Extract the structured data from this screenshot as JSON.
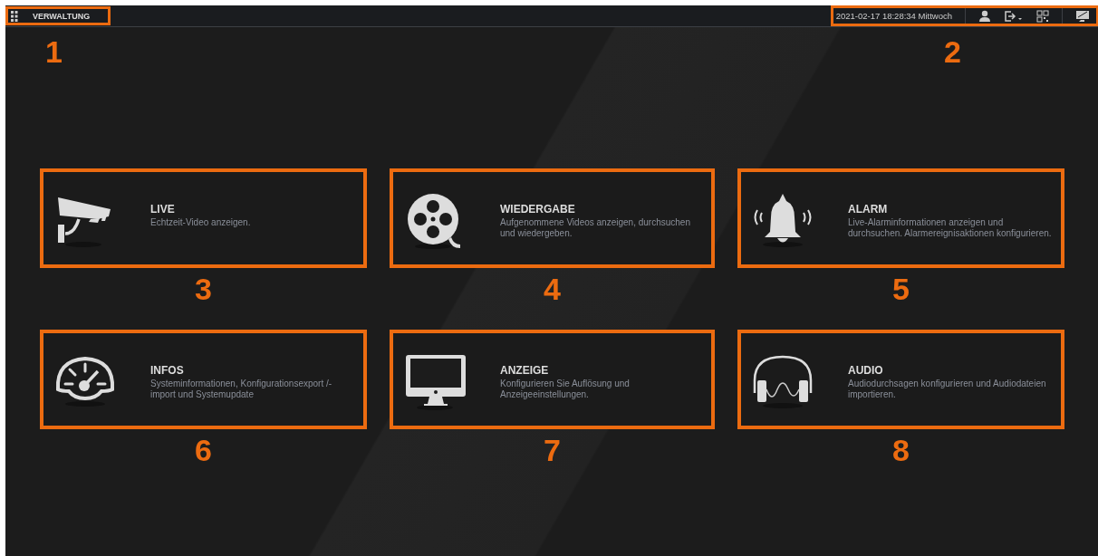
{
  "header": {
    "menu_label": "VERWALTUNG",
    "menu_callout": "1",
    "datetime": "2021-02-17 18:28:34 Mittwoch",
    "toolbar_callout": "2"
  },
  "tiles": [
    {
      "kind": "live",
      "title": "LIVE",
      "description": "Echtzeit-Video anzeigen.",
      "callout": "3"
    },
    {
      "kind": "playback",
      "title": "WIEDERGABE",
      "description": "Aufgenommene Videos anzeigen, durchsuchen und wiedergeben.",
      "callout": "4"
    },
    {
      "kind": "alarm",
      "title": "ALARM",
      "description": "Live-Alarminformationen anzeigen und durchsuchen. Alarmereignisaktionen konfigurieren.",
      "callout": "5"
    },
    {
      "kind": "info",
      "title": "INFOS",
      "description": "Systeminformationen, Konfigurationsexport /-import und Systemupdate",
      "callout": "6"
    },
    {
      "kind": "display",
      "title": "ANZEIGE",
      "description": "Konfigurieren Sie Auflösung und Anzeigeeinstellungen.",
      "callout": "7"
    },
    {
      "kind": "audio",
      "title": "AUDIO",
      "description": "Audiodurchsagen konfigurieren und Audiodateien importieren.",
      "callout": "8"
    }
  ]
}
